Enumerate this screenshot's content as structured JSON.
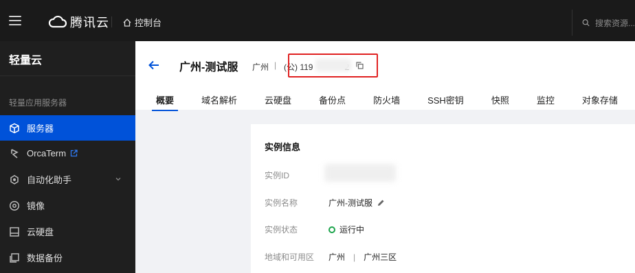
{
  "topbar": {
    "brand": "腾讯云",
    "console": "控制台",
    "search_placeholder": "搜索资源..."
  },
  "sidebar": {
    "title": "轻量云",
    "group": "轻量应用服务器",
    "items": [
      {
        "label": "服务器",
        "active": true
      },
      {
        "label": "OrcaTerm"
      },
      {
        "label": "自动化助手"
      },
      {
        "label": "镜像"
      },
      {
        "label": "云硬盘"
      },
      {
        "label": "数据备份"
      }
    ]
  },
  "header": {
    "title": "广州-测试服",
    "region": "广州",
    "separator": "|",
    "ip_prefix": "(公) 119",
    "ip_suffix": "2"
  },
  "tabs": [
    "概要",
    "域名解析",
    "云硬盘",
    "备份点",
    "防火墙",
    "SSH密钥",
    "快照",
    "监控",
    "对象存储"
  ],
  "card": {
    "title": "实例信息",
    "rows": [
      {
        "label": "实例ID",
        "value": ""
      },
      {
        "label": "实例名称",
        "value": "广州-测试服"
      },
      {
        "label": "实例状态",
        "value": "运行中"
      },
      {
        "label": "地域和可用区",
        "value": "广州",
        "sep": "|",
        "value2": "广州三区"
      }
    ]
  },
  "colors": {
    "accent": "#0052d9",
    "status": "#1aa34a",
    "highlight": "#e02020"
  }
}
